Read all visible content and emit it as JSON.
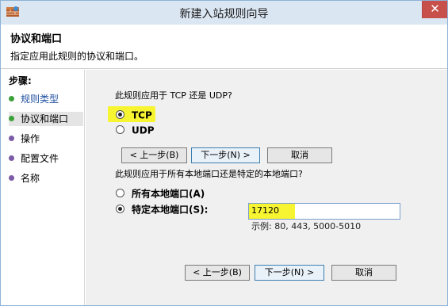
{
  "window": {
    "title": "新建入站规则向导",
    "close_label": "✕"
  },
  "header": {
    "title": "协议和端口",
    "subtitle": "指定应用此规则的协议和端口。"
  },
  "sidebar": {
    "steps_label": "步骤:",
    "items": [
      {
        "label": "规则类型",
        "state": "done"
      },
      {
        "label": "协议和端口",
        "state": "current"
      },
      {
        "label": "操作",
        "state": "pending"
      },
      {
        "label": "配置文件",
        "state": "pending"
      },
      {
        "label": "名称",
        "state": "pending"
      }
    ]
  },
  "protocol": {
    "question": "此规则应用于 TCP 还是 UDP?",
    "options": [
      {
        "label": "TCP",
        "selected": true
      },
      {
        "label": "UDP",
        "selected": false
      }
    ]
  },
  "overlay_buttons": {
    "back": "< 上一步(B)",
    "next": "下一步(N) >",
    "cancel": "取消"
  },
  "ports": {
    "question": "此规则应用于所有本地端口还是特定的本地端口?",
    "all_label": "所有本地端口(A)",
    "specific_label": "特定本地端口(S):",
    "value": "17120",
    "example": "示例: 80, 443, 5000-5010"
  },
  "footer_buttons": {
    "back": "< 上一步(B)",
    "next": "下一步(N) >",
    "cancel": "取消"
  },
  "colors": {
    "highlight": "#f7f531",
    "titlebar": "#dbe6f3",
    "close": "#c7504a"
  }
}
